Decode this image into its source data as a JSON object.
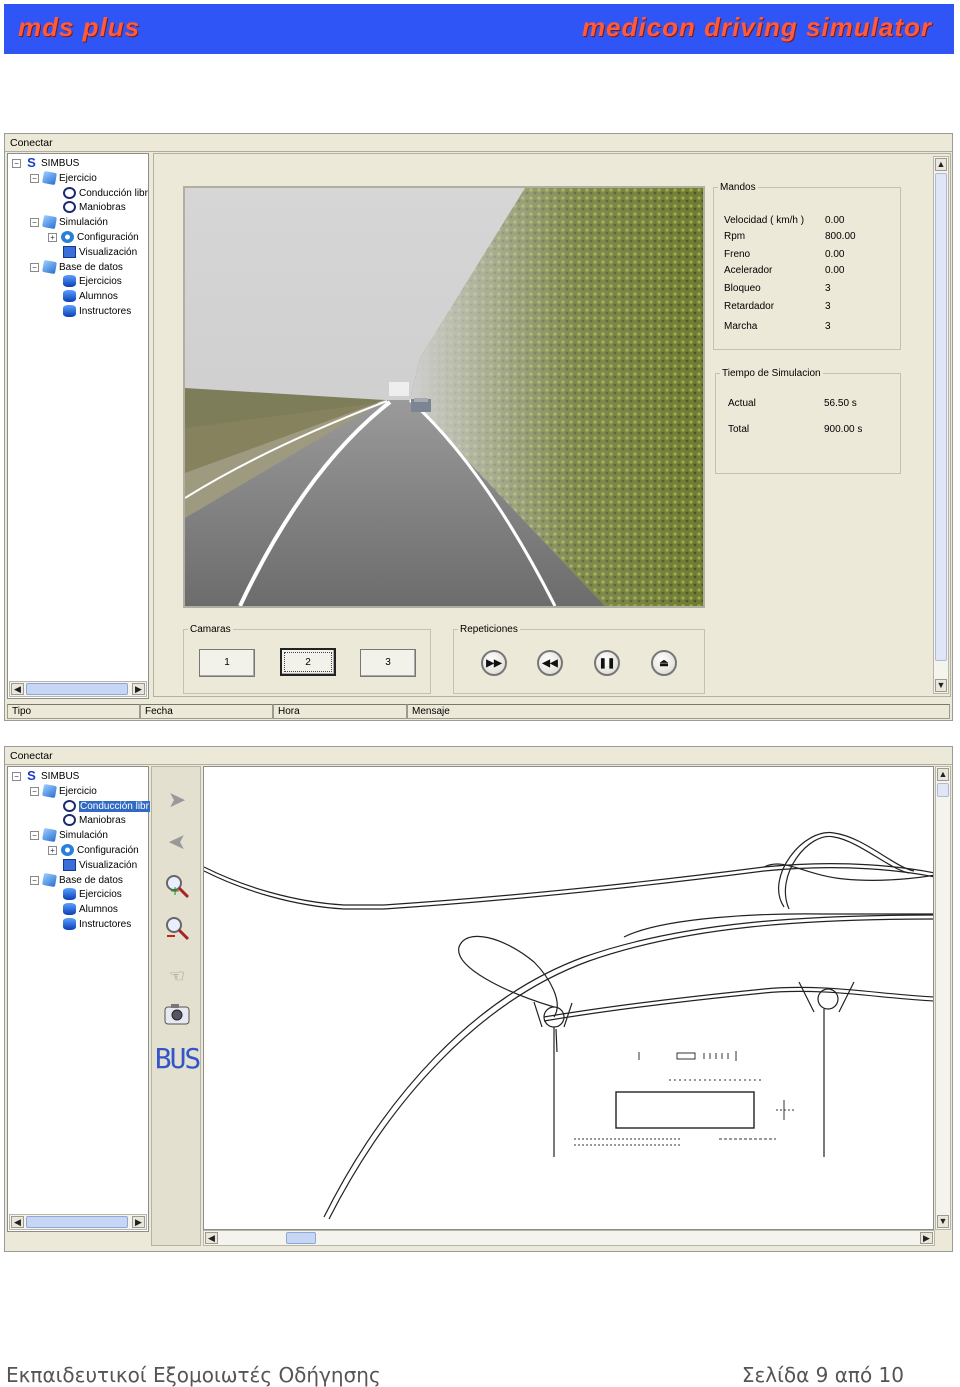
{
  "banner": {
    "left": "mds plus",
    "right": "medicon driving simulator"
  },
  "menu": {
    "conectar": "Conectar"
  },
  "tree": {
    "root": "SIMBUS",
    "ejercicio": "Ejercicio",
    "conduccion": "Conducción libr",
    "maniobras": "Maniobras",
    "simulacion": "Simulación",
    "configuracion": "Configuración",
    "visualizacion": "Visualización",
    "base": "Base de datos",
    "ejercicios": "Ejercicios",
    "alumnos": "Alumnos",
    "instructores": "Instructores"
  },
  "mandos": {
    "title": "Mandos",
    "rows": [
      {
        "label": "Velocidad ( km/h )",
        "value": "0.00"
      },
      {
        "label": "Rpm",
        "value": "800.00"
      },
      {
        "label": "Freno",
        "value": "0.00"
      },
      {
        "label": "Acelerador",
        "value": "0.00"
      },
      {
        "label": "Bloqueo",
        "value": "3"
      },
      {
        "label": "Retardador",
        "value": "3"
      },
      {
        "label": "Marcha",
        "value": "3"
      }
    ]
  },
  "tiempo": {
    "title": "Tiempo de Simulacion",
    "actual_label": "Actual",
    "actual_value": "56.50 s",
    "total_label": "Total",
    "total_value": "900.00 s"
  },
  "camaras": {
    "title": "Camaras",
    "b1": "1",
    "b2": "2",
    "b3": "3",
    "selected": "2"
  },
  "repeticiones": {
    "title": "Repeticiones",
    "icons": [
      "fast-forward-icon",
      "rewind-icon",
      "pause-icon",
      "eject-icon"
    ]
  },
  "status": {
    "tipo": "Tipo",
    "fecha": "Fecha",
    "hora": "Hora",
    "mensaje": "Mensaje"
  },
  "toolbar": {
    "bus_label": "BUS",
    "icons": [
      "arrow-right-icon",
      "arrow-left-icon",
      "zoom-in-icon",
      "zoom-out-icon",
      "hand-icon",
      "camera-icon"
    ]
  },
  "footer": {
    "left": "Εκπαιδευτικοί Εξομοιωτές Οδήγησης",
    "right": "Σελίδα 9 από 10"
  },
  "colors": {
    "banner_bg": "#2f55f6",
    "banner_text": "#ff5a3c",
    "window_bg": "#ece9d8",
    "selection": "#316ac5"
  }
}
